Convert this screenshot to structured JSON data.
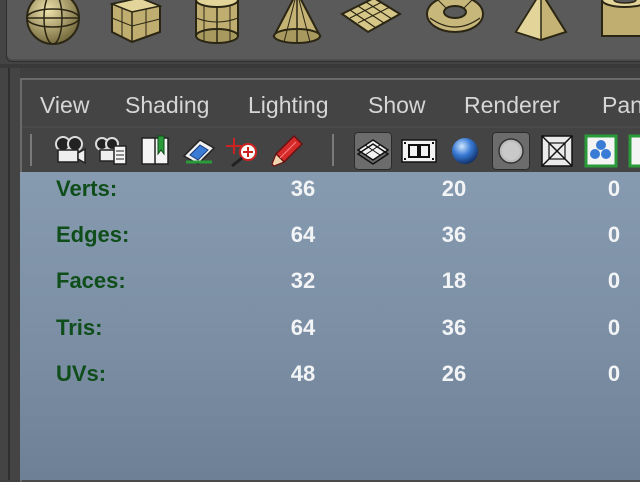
{
  "shelf": {
    "items": [
      {
        "icon": "sphere-icon"
      },
      {
        "icon": "cube-icon"
      },
      {
        "icon": "cylinder-icon"
      },
      {
        "icon": "cone-icon"
      },
      {
        "icon": "plane-icon"
      },
      {
        "icon": "torus-icon"
      },
      {
        "icon": "pyramid-icon"
      },
      {
        "icon": "pipe-icon"
      }
    ]
  },
  "menu": {
    "items": [
      {
        "label": "View"
      },
      {
        "label": "Shading"
      },
      {
        "label": "Lighting"
      },
      {
        "label": "Show"
      },
      {
        "label": "Renderer"
      },
      {
        "label": "Pan"
      }
    ]
  },
  "toolbar": {
    "icons": [
      "select-camera-icon",
      "camera-attributes-icon",
      "bookmarks-icon",
      "image-plane-icon",
      "two-d-pan-zoom-icon",
      "grease-pencil-icon",
      "wireframe-on-shaded-icon",
      "film-gate-icon",
      "smooth-shade-icon",
      "flat-shade-icon",
      "xray-icon",
      "isolate-select-icon",
      "next-icon"
    ],
    "active": [
      "wireframe-on-shaded-icon",
      "flat-shade-icon"
    ]
  },
  "hud": {
    "rows": [
      {
        "label": "Verts:",
        "col1": "36",
        "col2": "20",
        "col3": "0"
      },
      {
        "label": "Edges:",
        "col1": "64",
        "col2": "36",
        "col3": "0"
      },
      {
        "label": "Faces:",
        "col1": "32",
        "col2": "18",
        "col3": "0"
      },
      {
        "label": "Tris:",
        "col1": "64",
        "col2": "36",
        "col3": "0"
      },
      {
        "label": "UVs:",
        "col1": "48",
        "col2": "26",
        "col3": "0"
      }
    ]
  },
  "colors": {
    "hud_label": "#0f4e1a",
    "hud_value": "#f2f4f6",
    "viewport_top": "#869ab0",
    "viewport_bottom": "#6d8096",
    "menu_text": "#d6d6d6",
    "primitive_gold": "#c8b77a"
  }
}
